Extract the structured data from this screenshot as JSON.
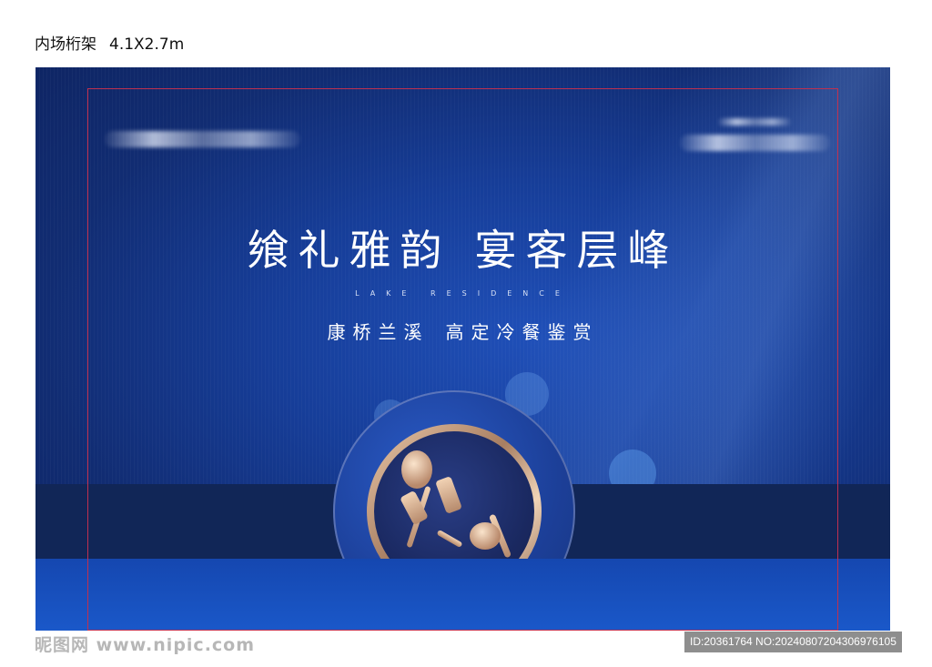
{
  "caption": {
    "title": "内场桁架",
    "size": "4.1X2.7m"
  },
  "board": {
    "headline_left": "飨礼雅韵",
    "headline_right": "宴客层峰",
    "subtitle_en": "LAKE RESIDENCE",
    "subtitle_cn_left": "康桥兰溪",
    "subtitle_cn_right": "高定冷餐鉴赏",
    "colors": {
      "background": "#163d98",
      "band": "#112657",
      "guide": "#c0304f",
      "rim": "#c9a284"
    }
  },
  "watermark": {
    "left": "昵图网 www.nipic.com",
    "right": "ID:20361764 NO:20240807204306976105"
  }
}
